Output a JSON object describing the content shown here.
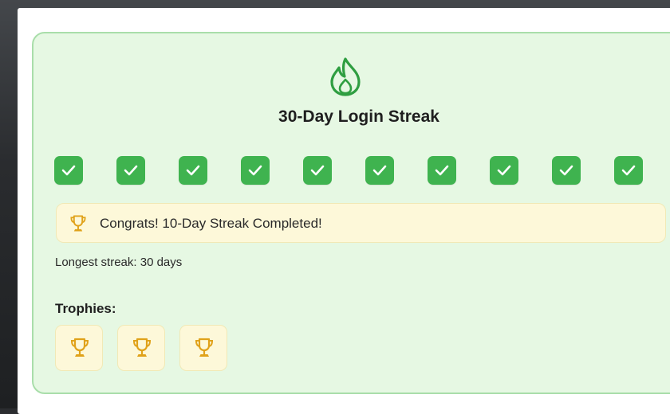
{
  "streak_card": {
    "icon": "flame-icon",
    "title": "30-Day Login Streak",
    "days_checked": 10,
    "banner": {
      "icon": "trophy-icon",
      "text": "Congrats! 10-Day Streak Completed!"
    },
    "longest_streak": "Longest streak: 30 days",
    "trophies_heading": "Trophies:",
    "trophies": [
      {
        "icon": "trophy-icon"
      },
      {
        "icon": "trophy-icon"
      },
      {
        "icon": "trophy-icon"
      }
    ]
  },
  "colors": {
    "accent_green": "#3fb34f",
    "card_bg": "#e6f8e3",
    "card_border": "#a9deaa",
    "banner_bg": "#fdf8d9",
    "trophy_gold": "#e0a21a"
  }
}
